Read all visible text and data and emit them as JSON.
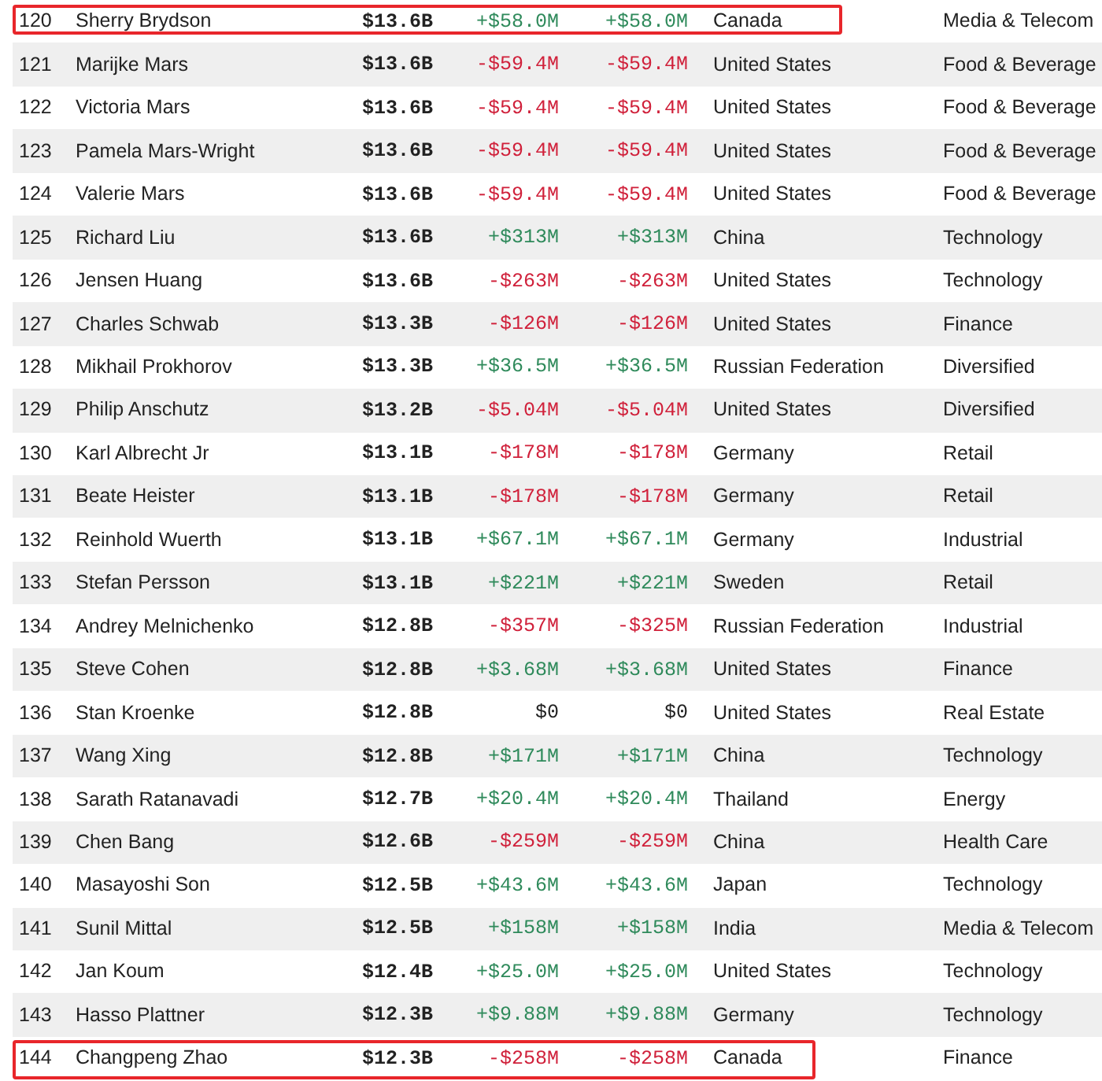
{
  "rows": [
    {
      "rank": "120",
      "name": "Sherry Brydson",
      "worth": "$13.6B",
      "change_1": "+$58.0M",
      "change_2": "+$58.0M",
      "color": "#2f8a5b",
      "country": "Canada",
      "industry": "Media & Telecom",
      "highlighted": true
    },
    {
      "rank": "121",
      "name": "Marijke Mars",
      "worth": "$13.6B",
      "change_1": "-$59.4M",
      "change_2": "-$59.4M",
      "color": "#d0213b",
      "country": "United States",
      "industry": "Food & Beverage",
      "highlighted": false
    },
    {
      "rank": "122",
      "name": "Victoria Mars",
      "worth": "$13.6B",
      "change_1": "-$59.4M",
      "change_2": "-$59.4M",
      "color": "#d0213b",
      "country": "United States",
      "industry": "Food & Beverage",
      "highlighted": false
    },
    {
      "rank": "123",
      "name": "Pamela Mars-Wright",
      "worth": "$13.6B",
      "change_1": "-$59.4M",
      "change_2": "-$59.4M",
      "color": "#d0213b",
      "country": "United States",
      "industry": "Food & Beverage",
      "highlighted": false
    },
    {
      "rank": "124",
      "name": "Valerie Mars",
      "worth": "$13.6B",
      "change_1": "-$59.4M",
      "change_2": "-$59.4M",
      "color": "#d0213b",
      "country": "United States",
      "industry": "Food & Beverage",
      "highlighted": false
    },
    {
      "rank": "125",
      "name": "Richard Liu",
      "worth": "$13.6B",
      "change_1": "+$313M",
      "change_2": "+$313M",
      "color": "#2f8a5b",
      "country": "China",
      "industry": "Technology",
      "highlighted": false
    },
    {
      "rank": "126",
      "name": "Jensen Huang",
      "worth": "$13.6B",
      "change_1": "-$263M",
      "change_2": "-$263M",
      "color": "#d0213b",
      "country": "United States",
      "industry": "Technology",
      "highlighted": false
    },
    {
      "rank": "127",
      "name": "Charles Schwab",
      "worth": "$13.3B",
      "change_1": "-$126M",
      "change_2": "-$126M",
      "color": "#d0213b",
      "country": "United States",
      "industry": "Finance",
      "highlighted": false
    },
    {
      "rank": "128",
      "name": "Mikhail Prokhorov",
      "worth": "$13.3B",
      "change_1": "+$36.5M",
      "change_2": "+$36.5M",
      "color": "#2f8a5b",
      "country": "Russian Federation",
      "industry": "Diversified",
      "highlighted": false
    },
    {
      "rank": "129",
      "name": "Philip Anschutz",
      "worth": "$13.2B",
      "change_1": "-$5.04M",
      "change_2": "-$5.04M",
      "color": "#d0213b",
      "country": "United States",
      "industry": "Diversified",
      "highlighted": false
    },
    {
      "rank": "130",
      "name": "Karl Albrecht Jr",
      "worth": "$13.1B",
      "change_1": "-$178M",
      "change_2": "-$178M",
      "color": "#d0213b",
      "country": "Germany",
      "industry": "Retail",
      "highlighted": false
    },
    {
      "rank": "131",
      "name": "Beate Heister",
      "worth": "$13.1B",
      "change_1": "-$178M",
      "change_2": "-$178M",
      "color": "#d0213b",
      "country": "Germany",
      "industry": "Retail",
      "highlighted": false
    },
    {
      "rank": "132",
      "name": "Reinhold Wuerth",
      "worth": "$13.1B",
      "change_1": "+$67.1M",
      "change_2": "+$67.1M",
      "color": "#2f8a5b",
      "country": "Germany",
      "industry": "Industrial",
      "highlighted": false
    },
    {
      "rank": "133",
      "name": "Stefan Persson",
      "worth": "$13.1B",
      "change_1": "+$221M",
      "change_2": "+$221M",
      "color": "#2f8a5b",
      "country": "Sweden",
      "industry": "Retail",
      "highlighted": false
    },
    {
      "rank": "134",
      "name": "Andrey Melnichenko",
      "worth": "$12.8B",
      "change_1": "-$357M",
      "change_2": "-$325M",
      "color": "#d0213b",
      "country": "Russian Federation",
      "industry": "Industrial",
      "highlighted": false
    },
    {
      "rank": "135",
      "name": "Steve Cohen",
      "worth": "$12.8B",
      "change_1": "+$3.68M",
      "change_2": "+$3.68M",
      "color": "#2f8a5b",
      "country": "United States",
      "industry": "Finance",
      "highlighted": false
    },
    {
      "rank": "136",
      "name": "Stan Kroenke",
      "worth": "$12.8B",
      "change_1": "$0",
      "change_2": "$0",
      "color": "#222222",
      "country": "United States",
      "industry": "Real Estate",
      "highlighted": false
    },
    {
      "rank": "137",
      "name": "Wang Xing",
      "worth": "$12.8B",
      "change_1": "+$171M",
      "change_2": "+$171M",
      "color": "#2f8a5b",
      "country": "China",
      "industry": "Technology",
      "highlighted": false
    },
    {
      "rank": "138",
      "name": "Sarath Ratanavadi",
      "worth": "$12.7B",
      "change_1": "+$20.4M",
      "change_2": "+$20.4M",
      "color": "#2f8a5b",
      "country": "Thailand",
      "industry": "Energy",
      "highlighted": false
    },
    {
      "rank": "139",
      "name": "Chen Bang",
      "worth": "$12.6B",
      "change_1": "-$259M",
      "change_2": "-$259M",
      "color": "#d0213b",
      "country": "China",
      "industry": "Health Care",
      "highlighted": false
    },
    {
      "rank": "140",
      "name": "Masayoshi Son",
      "worth": "$12.5B",
      "change_1": "+$43.6M",
      "change_2": "+$43.6M",
      "color": "#2f8a5b",
      "country": "Japan",
      "industry": "Technology",
      "highlighted": false
    },
    {
      "rank": "141",
      "name": "Sunil Mittal",
      "worth": "$12.5B",
      "change_1": "+$158M",
      "change_2": "+$158M",
      "color": "#2f8a5b",
      "country": "India",
      "industry": "Media & Telecom",
      "highlighted": false
    },
    {
      "rank": "142",
      "name": "Jan Koum",
      "worth": "$12.4B",
      "change_1": "+$25.0M",
      "change_2": "+$25.0M",
      "color": "#2f8a5b",
      "country": "United States",
      "industry": "Technology",
      "highlighted": false
    },
    {
      "rank": "143",
      "name": "Hasso Plattner",
      "worth": "$12.3B",
      "change_1": "+$9.88M",
      "change_2": "+$9.88M",
      "color": "#2f8a5b",
      "country": "Germany",
      "industry": "Technology",
      "highlighted": false
    },
    {
      "rank": "144",
      "name": "Changpeng Zhao",
      "worth": "$12.3B",
      "change_1": "-$258M",
      "change_2": "-$258M",
      "color": "#d0213b",
      "country": "Canada",
      "industry": "Finance",
      "highlighted": true
    }
  ]
}
